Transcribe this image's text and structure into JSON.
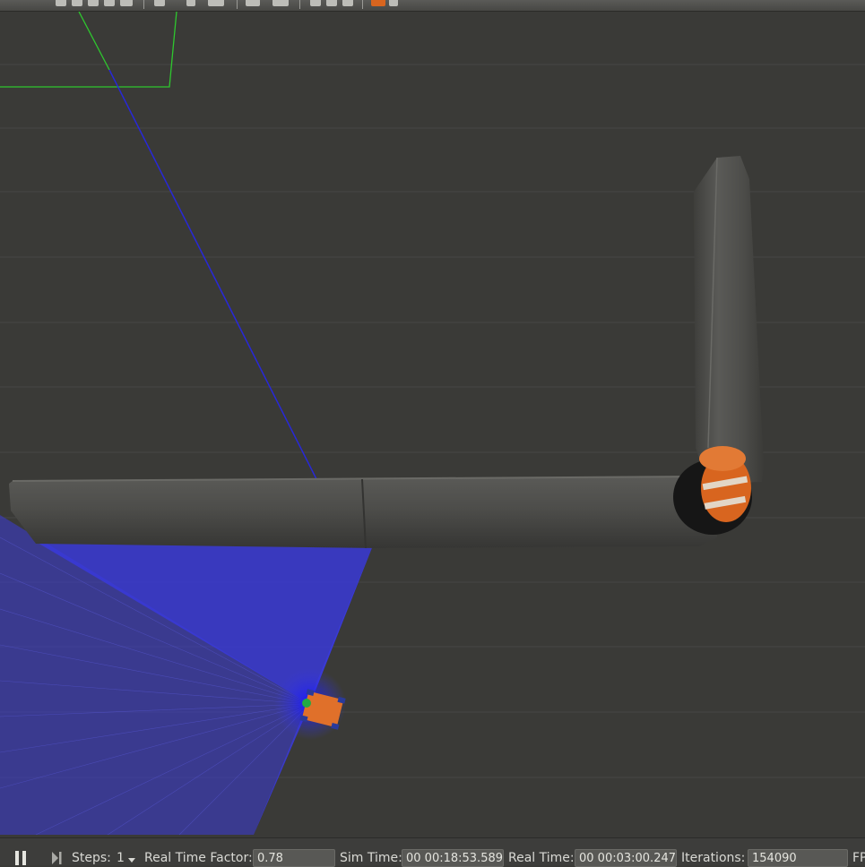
{
  "statusbar": {
    "pause_icon": "pause-icon",
    "step_icon": "step-forward-icon",
    "steps_label": "Steps:",
    "steps_value": "1",
    "rtf_label": "Real Time Factor:",
    "rtf_value": "0.78",
    "sim_time_label": "Sim Time:",
    "sim_time_value": "00 00:18:53.589",
    "real_time_label": "Real Time:",
    "real_time_value": "00 00:03:00.247",
    "iterations_label": "Iterations:",
    "iterations_value": "154090",
    "fps_label": "FP"
  },
  "colors": {
    "ground": "#3a3a37",
    "laser": "#3a3ae0",
    "wall": "#4a4a47",
    "barrel": "#d8651f",
    "robot": "#e0702a",
    "camera_frustum": "#2ec82e"
  }
}
